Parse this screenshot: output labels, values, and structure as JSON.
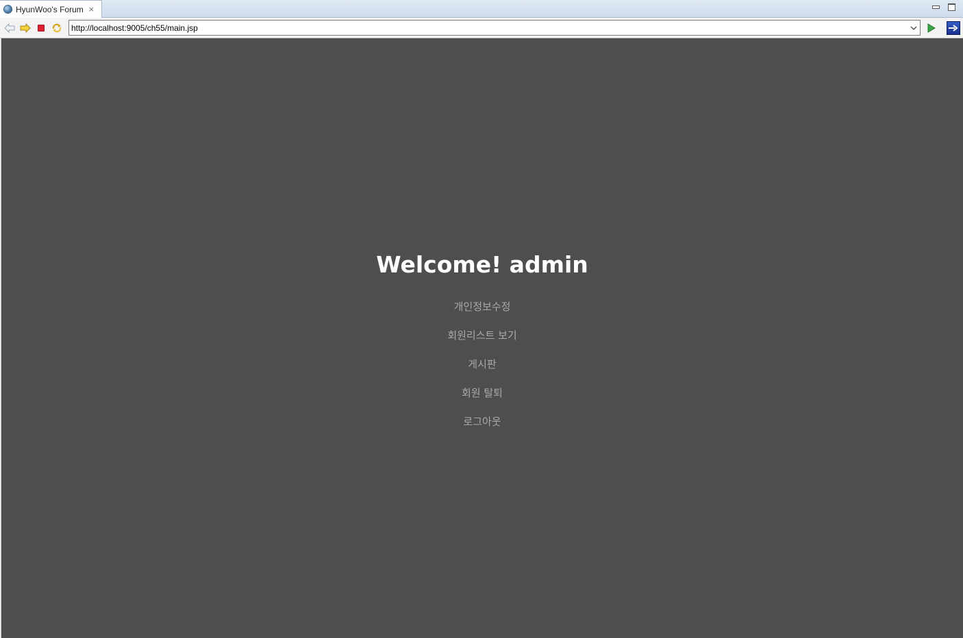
{
  "window": {
    "tab_title": "HyunWoo's Forum",
    "tab_icon": "globe-icon"
  },
  "toolbar": {
    "url": "http://localhost:9005/ch55/main.jsp",
    "icons": [
      "back-arrow-icon",
      "forward-arrow-icon",
      "stop-icon",
      "refresh-icon",
      "go-icon",
      "open-external-browser-icon"
    ]
  },
  "page": {
    "background_color": "#4e4e4e",
    "welcome_text": "Welcome! admin",
    "menu_items": [
      {
        "label": "개인정보수정"
      },
      {
        "label": "회원리스트 보기"
      },
      {
        "label": "게시판"
      },
      {
        "label": "회원 탈퇴"
      },
      {
        "label": "로그아웃"
      }
    ]
  }
}
